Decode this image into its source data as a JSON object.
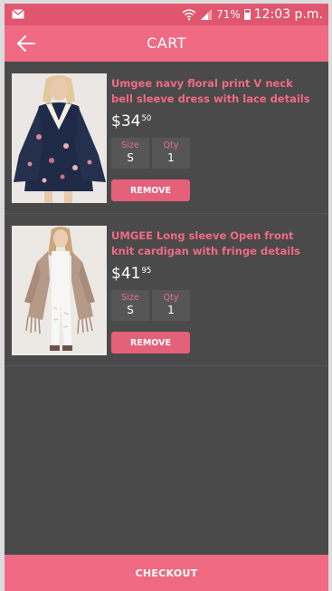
{
  "status_bar": {
    "battery": "71%",
    "time": "12:03 p.m.",
    "icons": [
      "mail-icon",
      "wifi-icon",
      "signal-icon",
      "battery-icon"
    ]
  },
  "header": {
    "title": "CART",
    "back_icon": "arrow-left-icon"
  },
  "cart": {
    "items": [
      {
        "title": "Umgee navy floral print V neck bell sleeve dress with lace details",
        "price_dollars": "$34",
        "price_cents": "50",
        "size_label": "Size",
        "size_value": "S",
        "qty_label": "Qty",
        "qty_value": "1",
        "remove_label": "REMOVE"
      },
      {
        "title": "UMGEE Long sleeve Open front knit cardigan with fringe details",
        "price_dollars": "$41",
        "price_cents": "95",
        "size_label": "Size",
        "size_value": "S",
        "qty_label": "Qty",
        "qty_value": "1",
        "remove_label": "REMOVE"
      }
    ]
  },
  "footer": {
    "checkout_label": "CHECKOUT"
  },
  "colors": {
    "primary": "#ef6a82",
    "status_bar": "#e0566f",
    "background": "#4a4a4a",
    "accent_text": "#f06a86"
  }
}
